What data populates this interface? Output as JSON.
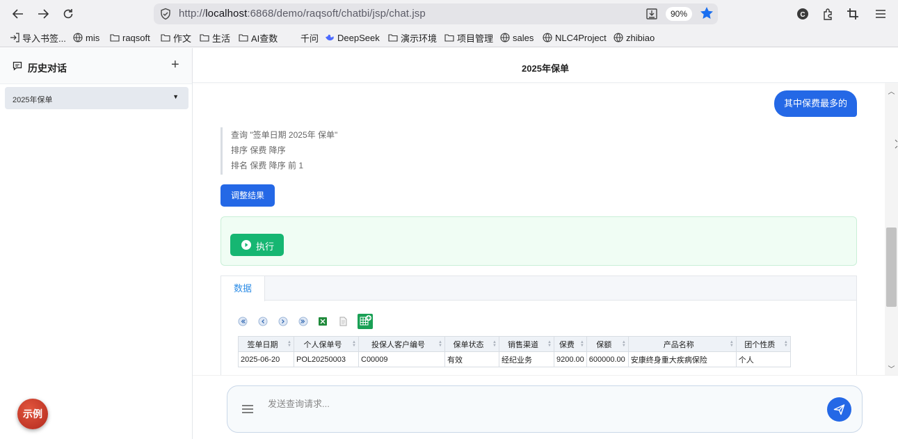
{
  "browser": {
    "url_prefix": "http://",
    "url_host": "localhost",
    "url_rest": ":6868/demo/raqsoft/chatbi/jsp/chat.jsp",
    "zoom": "90%"
  },
  "bookmarks": [
    {
      "label": "导入书签...",
      "icon": "import-icon"
    },
    {
      "label": "mis",
      "icon": "globe-icon"
    },
    {
      "label": "raqsoft",
      "icon": "folder-icon"
    },
    {
      "label": "作文",
      "icon": "folder-icon"
    },
    {
      "label": "生活",
      "icon": "folder-icon"
    },
    {
      "label": "AI查数",
      "icon": "folder-icon"
    },
    {
      "label": "千问",
      "icon": "blank-icon"
    },
    {
      "label": "DeepSeek",
      "icon": "deepseek-icon"
    },
    {
      "label": "演示环境",
      "icon": "folder-icon"
    },
    {
      "label": "项目管理",
      "icon": "folder-icon"
    },
    {
      "label": "sales",
      "icon": "globe-icon"
    },
    {
      "label": "NLC4Project",
      "icon": "globe-icon"
    },
    {
      "label": "zhibiao",
      "icon": "globe-icon"
    }
  ],
  "sidebar": {
    "title": "历史对话",
    "add": "+",
    "history": [
      {
        "label": "2025年保单"
      }
    ],
    "example_button": "示例"
  },
  "main": {
    "title": "2025年保单",
    "user_message": "其中保费最多的",
    "query_lines": [
      "查询 \"签单日期 2025年 保单\"",
      "排序 保费 降序",
      "排名 保费 降序 前 1"
    ],
    "adjust_button": "调整结果",
    "execute_button": "执行",
    "tab_label": "数据",
    "table": {
      "columns": [
        "签单日期",
        "个人保单号",
        "投保人客户编号",
        "保单状态",
        "销售渠道",
        "保费",
        "保额",
        "产品名称",
        "团个性质"
      ],
      "rows": [
        [
          "2025-06-20",
          "POL20250003",
          "C00009",
          "有效",
          "经纪业务",
          "9200.00",
          "600000.00",
          "安康终身重大疾病保险",
          "个人"
        ]
      ]
    },
    "input_placeholder": "发送查询请求..."
  },
  "colors": {
    "accent": "#2468e6",
    "execute": "#16b672",
    "example": "#c0392b"
  }
}
